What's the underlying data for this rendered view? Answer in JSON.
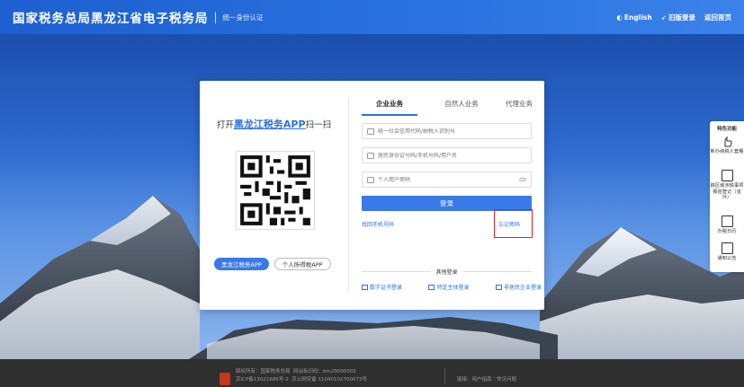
{
  "header": {
    "title": "国家税务总局黑龙江省电子税务局",
    "separator": "|",
    "subtitle": "统一身份认证",
    "links": [
      "English",
      "旧版登录",
      "返回首页"
    ]
  },
  "card": {
    "open_app_prefix": "打开",
    "open_app_name": "黑龙江税务APP",
    "open_app_suffix": "扫一扫",
    "app_buttons": [
      "黑龙江税务APP",
      "个人所得税APP"
    ],
    "tabs": [
      "企业业务",
      "自然人业务",
      "代理业务"
    ],
    "fields": {
      "credit_code_placeholder": "统一社会信用代码/纳税人识别号",
      "id_placeholder": "居民身份证号码/手机号码/用户名",
      "password_placeholder": "个人用户密码"
    },
    "login_label": "登录",
    "retrieve_phone": "找回手机号码",
    "forgot_password": "忘记密码",
    "other_login_title": "其他登录",
    "other_logins": [
      "数字证书登录",
      "特定主体登录",
      "非居民企业登录"
    ]
  },
  "side_panel": {
    "head": "特色功能",
    "items": [
      "新办纳税人套餐",
      "跨区域涉税事项报验登记（省外）",
      "办税日历",
      "通知公告"
    ]
  },
  "footer": {
    "copyright": "版权所有：国家税务总局",
    "site_code": "网站标识码：bm29000002",
    "icp": "京ICP备13021685号-2",
    "police": "京公网安备 11040102700073号",
    "links": "链接：用户指南｜常见问题"
  },
  "colors": {
    "accent": "#3a7ae8",
    "highlight": "#e02020",
    "footer_bg": "#2f2f2f"
  }
}
